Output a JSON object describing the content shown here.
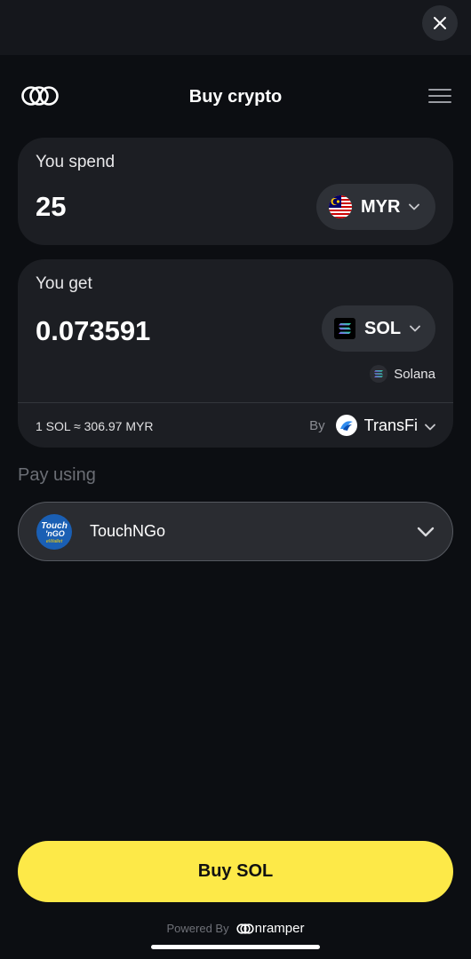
{
  "header": {
    "title": "Buy crypto",
    "close_icon": "close-icon",
    "menu_icon": "hamburger-menu-icon",
    "logo_icon": "onramper-logo-icon"
  },
  "spend": {
    "label": "You spend",
    "amount": "25",
    "currency": "MYR",
    "flag_icon": "malaysia-flag-icon"
  },
  "get": {
    "label": "You get",
    "amount": "0.073591",
    "currency": "SOL",
    "network": "Solana",
    "rate": "1 SOL ≈ 306.97 MYR",
    "by_label": "By",
    "provider": "TransFi"
  },
  "payment": {
    "label": "Pay using",
    "method": "TouchNGo",
    "logo_line1": "Touch",
    "logo_line2": "'nGO",
    "logo_line3": "eWallet"
  },
  "buy_button": {
    "label": "Buy SOL"
  },
  "footer": {
    "powered_by": "Powered By",
    "brand": "nramper"
  },
  "colors": {
    "background": "#0c0e12",
    "card": "#1c1e23",
    "accent": "#fde948"
  }
}
